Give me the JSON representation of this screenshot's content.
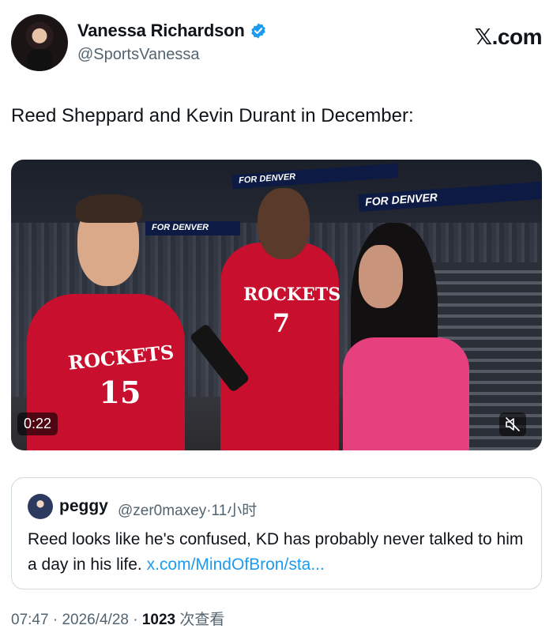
{
  "author": {
    "display_name": "Vanessa Richardson",
    "handle": "@SportsVanessa",
    "verified": true
  },
  "brand": "𝕏.com",
  "tweet": {
    "text": "Reed Sheppard and Kevin Durant in December:"
  },
  "video": {
    "duration": "0:22",
    "scene_text": {
      "banner_a": "FOR DENVER",
      "banner_b": "FOR DENVER",
      "banner_c": "FOR DENVER",
      "jersey_left_word": "ROCKETS",
      "jersey_left_number": "15",
      "jersey_right_word": "ROCKETS",
      "jersey_right_number": "7"
    },
    "muted": true
  },
  "quote": {
    "name": "peggy",
    "handle": "@zer0maxey",
    "separator": "·",
    "time": "11小时",
    "text": "Reed looks like he's confused, KD has probably never talked to him a day in his life.",
    "link": "x.com/MindOfBron/sta..."
  },
  "footer": {
    "time": "07:47",
    "date": "2026/4/28",
    "views": "1023",
    "views_label": "次查看"
  },
  "colors": {
    "text": "#0f1419",
    "secondary": "#536471",
    "link": "#1d9bf0",
    "verified": "#1d9bf0",
    "jersey_red": "#c8102e",
    "pink": "#e6407e"
  }
}
